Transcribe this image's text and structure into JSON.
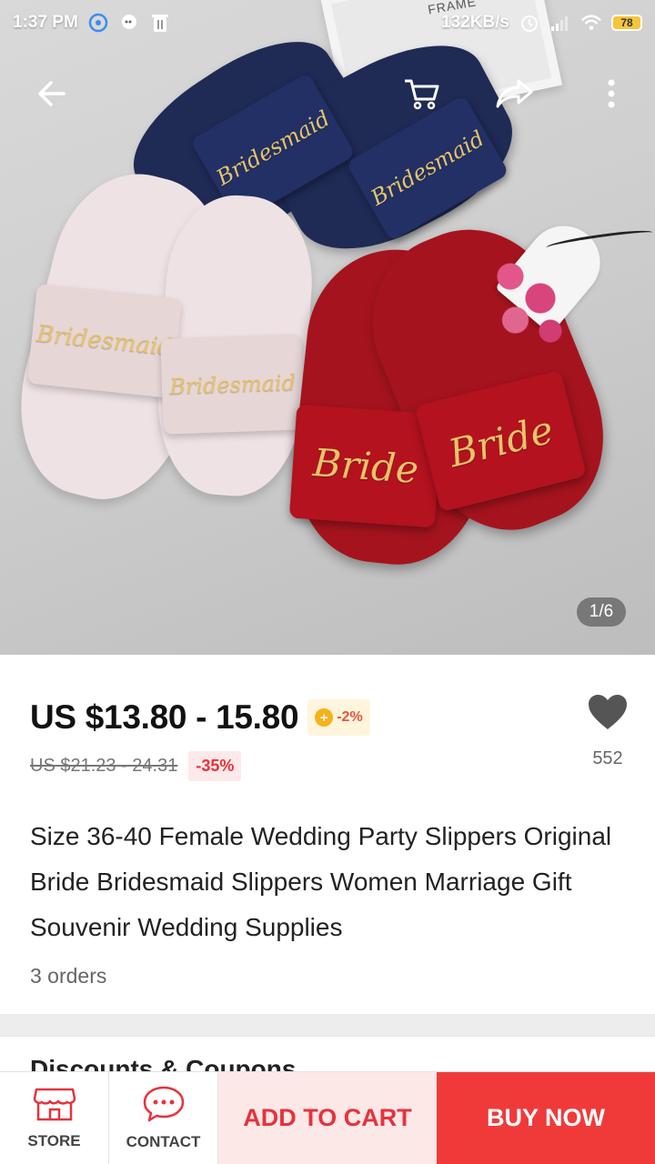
{
  "status_bar": {
    "time": "1:37 PM",
    "network_speed": "132KB/s",
    "battery": "78"
  },
  "hero": {
    "image_counter": "1/6",
    "strap_texts": {
      "navy_left": "Bridesmaid",
      "navy_right": "Bridesmaid",
      "pink_left": "Bridesmaid",
      "pink_right": "Bridesmaid",
      "red_left": "Bride",
      "red_right": "Bride"
    },
    "frame_text": "FRAME"
  },
  "product": {
    "price": "US $13.80 - 15.80",
    "coin_discount": "-2%",
    "original_price": "US $21.23 - 24.31",
    "discount": "-35%",
    "wishlist_count": "552",
    "title": "Size 36-40 Female Wedding Party Slippers Original Bride Bridesmaid Slippers Women Marriage Gift Souvenir Wedding Supplies",
    "orders": "3 orders"
  },
  "next_section": {
    "title": "Discounts & Coupons"
  },
  "bottom_bar": {
    "store_label": "STORE",
    "contact_label": "CONTACT",
    "add_to_cart_label": "ADD TO CART",
    "buy_now_label": "BUY NOW"
  },
  "colors": {
    "accent_red": "#f03a3a",
    "add_to_cart_bg": "#fde8e8",
    "coin_gold": "#f7b21b"
  },
  "icons": [
    "back-arrow-icon",
    "cart-icon",
    "share-icon",
    "more-vert-icon",
    "heart-icon",
    "store-icon",
    "chat-icon"
  ]
}
